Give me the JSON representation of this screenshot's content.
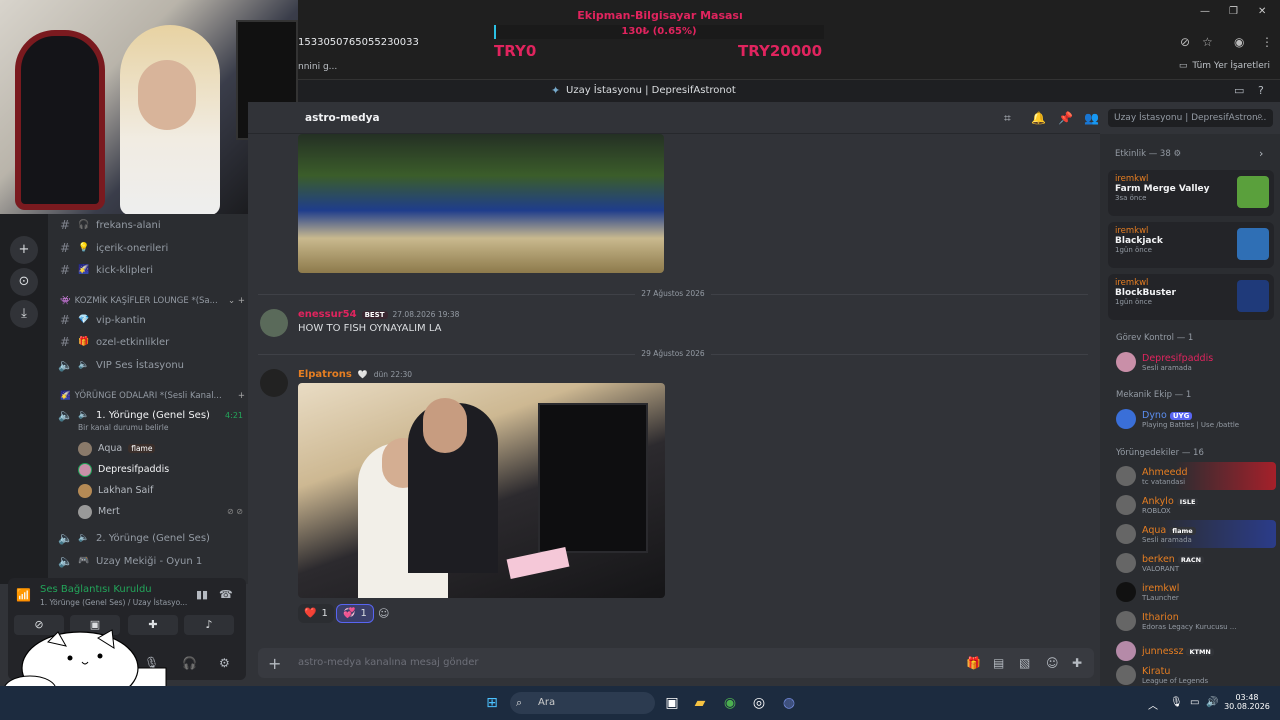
{
  "overlay_goal": {
    "title": "Ekipman-Bilgisayar Masası",
    "percent_text": "130₺ (0.65%)",
    "min_label": "TRY0",
    "max_label": "TRY20000",
    "progress_fraction": 0.0065
  },
  "browser": {
    "url": "1533050765055230033",
    "bookmark_left": "nnini g...",
    "bookmark_right": "Tüm Yer İşaretleri"
  },
  "window": {
    "title": "Uzay İstasyonu | DepresifAstronot"
  },
  "channels": [
    {
      "emoji": "🎧",
      "label": "frekans-alani"
    },
    {
      "emoji": "💡",
      "label": "içerik-onerileri"
    },
    {
      "emoji": "🌠",
      "label": "kick-klipleri"
    }
  ],
  "category_kozmik": "KOZMİK KAŞİFLER LOUNGE *(Sa...",
  "channels2": [
    {
      "emoji": "💎",
      "label": "vip-kantin"
    },
    {
      "emoji": "🎁",
      "label": "ozel-etkinlikler"
    },
    {
      "emoji": "",
      "label": "VIP Ses İstasyonu",
      "voice": true
    }
  ],
  "category_yorunge": "YÖRÜNGE ODALARI *(Sesli Kanal...",
  "active_voice": {
    "label": "1. Yörünge (Genel Ses)",
    "time": "4:21",
    "status_hint": "Bir kanal durumu belirle"
  },
  "voice_users": [
    {
      "name": "Aqua",
      "badge": "flame"
    },
    {
      "name": "Depresifpaddis",
      "badge": ""
    },
    {
      "name": "Lakhan Saif",
      "badge": ""
    },
    {
      "name": "Mert",
      "badge": ""
    }
  ],
  "voice_channels_extra": [
    {
      "label": "2. Yörünge (Genel Ses)"
    },
    {
      "label": "Uzay Mekiği - Oyun 1"
    }
  ],
  "voice_panel": {
    "title": "Ses Bağlantısı Kuruldu",
    "subtitle": "1. Yörünge (Genel Ses) / Uzay İstasyo..."
  },
  "channel_header": {
    "name": "astro-medya",
    "search_placeholder": "Uzay İstasyonu | DepresifAstron..."
  },
  "messages": {
    "date1": "27 Ağustos 2026",
    "msg1": {
      "author": "enessur54",
      "tag": "BEST",
      "time": "27.08.2026 19:38",
      "text": "HOW TO FISH OYNAYALIM LA"
    },
    "date2": "29 Ağustos 2026",
    "msg2": {
      "author": "Elpatrons",
      "time": "dün 22:30"
    },
    "reactions": [
      {
        "emoji": "❤️",
        "count": "1"
      },
      {
        "emoji": "💞",
        "count": "1"
      }
    ]
  },
  "composer": {
    "placeholder": "astro-medya kanalına mesaj gönder"
  },
  "activity": {
    "header": "Etkinlik — 38",
    "items": [
      {
        "user": "iremkwl",
        "game": "Farm Merge Valley",
        "when": "3sa önce",
        "color": "#5aa03c"
      },
      {
        "user": "iremkwl",
        "game": "Blackjack",
        "when": "1gün önce",
        "color": "#2f6fb5"
      },
      {
        "user": "iremkwl",
        "game": "BlockBuster",
        "when": "1gün önce",
        "color": "#1f3a7a"
      }
    ]
  },
  "roles": [
    {
      "header": "Görev Kontrol — 1",
      "members": [
        {
          "name": "Depresifpaddis",
          "status": "Sesli aramada",
          "color": "#e0245e",
          "tag": ""
        }
      ]
    },
    {
      "header": "Mekanik Ekip — 1",
      "members": [
        {
          "name": "Dyno",
          "status": "Playing Battles | Use /battle",
          "color": "#5b8def",
          "tag": "UYG"
        }
      ]
    },
    {
      "header": "Yörüngedekiler — 16",
      "members": [
        {
          "name": "Ahmeedd",
          "status": "tc vatandasi",
          "color": "#e67e22",
          "tag": ""
        },
        {
          "name": "Ankylo",
          "status": "ROBLOX",
          "color": "#e67e22",
          "tag": "ISLE"
        },
        {
          "name": "Aqua",
          "status": "Sesli aramada",
          "color": "#e67e22",
          "tag": "flame"
        },
        {
          "name": "berken",
          "status": "VALORANT",
          "color": "#e67e22",
          "tag": "RACN"
        },
        {
          "name": "iremkwl",
          "status": "TLauncher",
          "color": "#e67e22",
          "tag": ""
        },
        {
          "name": "Itharion",
          "status": "Edoras Legacy Kurucusu ...",
          "color": "#e67e22",
          "tag": ""
        },
        {
          "name": "junnessz",
          "status": "",
          "color": "#e67e22",
          "tag": "KTMN"
        },
        {
          "name": "Kiratu",
          "status": "League of Legends",
          "color": "#e67e22",
          "tag": ""
        }
      ]
    }
  ],
  "taskbar": {
    "search": "Ara",
    "time": "03:48",
    "date": "30.08.2026"
  }
}
